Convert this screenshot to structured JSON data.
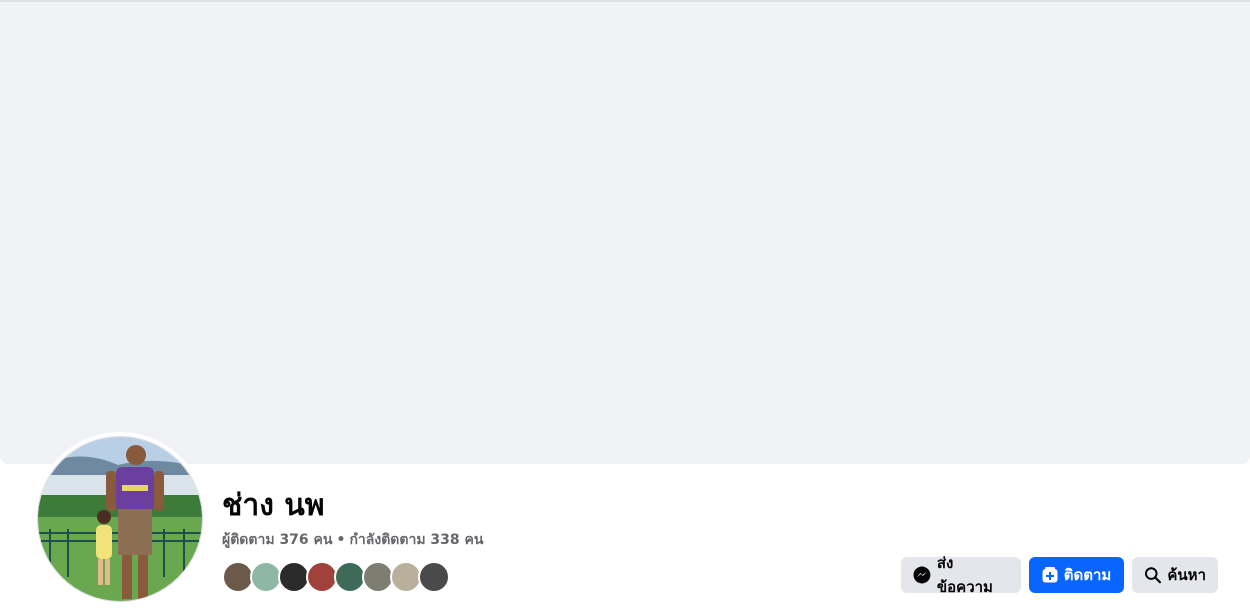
{
  "profile": {
    "name": "ช่าง นพ",
    "followers_text": "ผู้ติดตาม 376 คน",
    "separator": "•",
    "following_text": "กำลังติดตาม 338 คน"
  },
  "friend_avatars": [
    {
      "color": "#6b5a4a"
    },
    {
      "color": "#8fb7a6"
    },
    {
      "color": "#2b2b2b"
    },
    {
      "color": "#a0423a"
    },
    {
      "color": "#3f6a5a"
    },
    {
      "color": "#7d7d72"
    },
    {
      "color": "#b8b09a"
    },
    {
      "color": "#4a4a4a"
    }
  ],
  "actions": {
    "message_label": "ส่งข้อความ",
    "follow_label": "ติดตาม",
    "search_label": "ค้นหา"
  },
  "colors": {
    "accent": "#0866ff",
    "cover": "#f0f2f5",
    "button_gray": "#e4e6eb"
  }
}
